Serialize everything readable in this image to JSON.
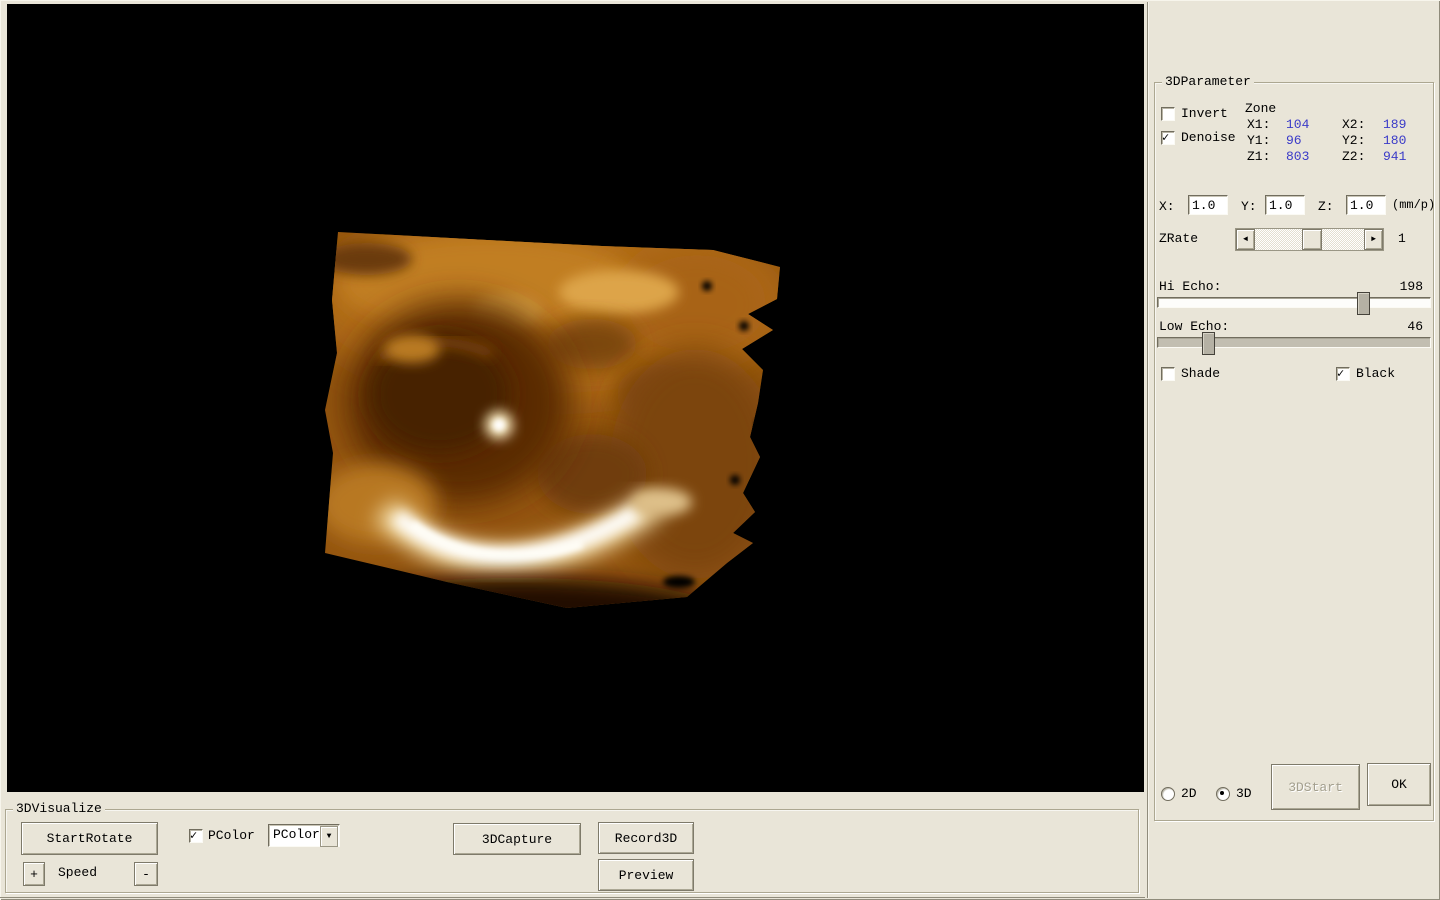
{
  "right_panel": {
    "group_title": "3DParameter",
    "invert": {
      "label": "Invert",
      "checked": false
    },
    "denoise": {
      "label": "Denoise",
      "checked": true
    },
    "zone": {
      "title": "Zone",
      "value_color": "#3a3ac8",
      "rows": [
        {
          "l1": "X1:",
          "v1": "104",
          "l2": "X2:",
          "v2": "189"
        },
        {
          "l1": "Y1:",
          "v1": "96",
          "l2": "Y2:",
          "v2": "180"
        },
        {
          "l1": "Z1:",
          "v1": "803",
          "l2": "Z2:",
          "v2": "941"
        }
      ]
    },
    "scale": {
      "x_label": "X:",
      "x_value": "1.0",
      "y_label": "Y:",
      "y_value": "1.0",
      "z_label": "Z:",
      "z_value": "1.0",
      "unit": "(mm/p)"
    },
    "zrate": {
      "label": "ZRate",
      "value": "1",
      "left_arrow": "◄",
      "right_arrow": "►",
      "percent": 45
    },
    "hi_echo": {
      "label": "Hi Echo:",
      "value": "198",
      "percent": 73
    },
    "low_echo": {
      "label": "Low Echo:",
      "value": "46",
      "percent": 16
    },
    "shade": {
      "label": "Shade",
      "checked": false
    },
    "black": {
      "label": "Black",
      "checked": true
    },
    "mode": {
      "label_2d": "2D",
      "label_3d": "3D",
      "is2d": false,
      "is3d": true
    },
    "start_button": {
      "label": "3DStart",
      "disabled": true
    },
    "ok_button": {
      "label": "OK"
    }
  },
  "bottom_panel": {
    "group_title": "3DVisualize",
    "start_rotate": "StartRotate",
    "pcolor_check": {
      "label": "PColor",
      "checked": true
    },
    "pcolor_combo": {
      "value": "PColor",
      "arrow": "▼"
    },
    "capture_button": "3DCapture",
    "record_button": "Record3D",
    "preview_button": "Preview",
    "speed": {
      "plus": "+",
      "label": "Speed",
      "minus": "-"
    }
  },
  "viewport": {
    "description": "3D ultrasound volume render, amber color map on black",
    "colors": {
      "base": "#94550f",
      "highlight": "#ffffff",
      "shadow": "#47210"
    }
  }
}
